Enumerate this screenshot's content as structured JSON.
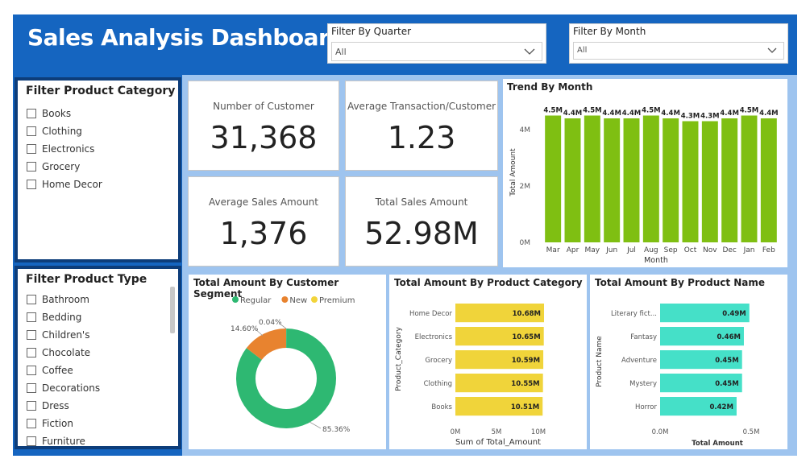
{
  "header": {
    "title": "Sales Analysis Dashboard"
  },
  "filters": {
    "quarter": {
      "label": "Filter By Quarter",
      "value": "All"
    },
    "month": {
      "label": "Filter By Month",
      "value": "All"
    }
  },
  "category_filter": {
    "title": "Filter Product Category",
    "items": [
      "Books",
      "Clothing",
      "Electronics",
      "Grocery",
      "Home Decor"
    ]
  },
  "type_filter": {
    "title": "Filter Product Type",
    "items": [
      "Bathroom",
      "Bedding",
      "Children's",
      "Chocolate",
      "Coffee",
      "Decorations",
      "Dress",
      "Fiction",
      "Furniture"
    ]
  },
  "kpis": {
    "customers": {
      "label": "Number of Customer",
      "value": "31,368"
    },
    "avg_txn": {
      "label": "Average Transaction/Customer",
      "value": "1.23"
    },
    "avg_sales": {
      "label": "Average Sales Amount",
      "value": "1,376"
    },
    "total_sales": {
      "label": "Total Sales Amount",
      "value": "52.98M"
    }
  },
  "colors": {
    "frame": "#1565C0",
    "dark_border": "#0d3d7a",
    "panel_bg": "#9ec4ef",
    "green_bar": "#7FBF12",
    "yellow_bar": "#F0D43A",
    "teal_bar": "#45E0C8",
    "regular": "#2EB872",
    "new": "#E8832F",
    "premium": "#F2D43A"
  },
  "chart_data": [
    {
      "id": "trend",
      "type": "bar",
      "title": "Trend By Month",
      "xlabel": "Month",
      "ylabel": "Total Amount",
      "categories": [
        "Mar",
        "Apr",
        "May",
        "Jun",
        "Jul",
        "Aug",
        "Sep",
        "Oct",
        "Nov",
        "Dec",
        "Jan",
        "Feb"
      ],
      "values": [
        4.5,
        4.4,
        4.5,
        4.4,
        4.4,
        4.5,
        4.4,
        4.3,
        4.3,
        4.4,
        4.5,
        4.4
      ],
      "labels": [
        "4.5M",
        "4.4M",
        "4.5M",
        "4.4M",
        "4.4M",
        "4.5M",
        "4.4M",
        "4.3M",
        "4.3M",
        "4.4M",
        "4.5M",
        "4.4M"
      ],
      "yticks": [
        "0M",
        "2M",
        "4M"
      ],
      "ylim": [
        0,
        5
      ]
    },
    {
      "id": "segment",
      "type": "pie",
      "title": "Total Amount By Customer Segment",
      "categories": [
        "Regular",
        "New",
        "Premium"
      ],
      "values": [
        85.36,
        14.6,
        0.04
      ],
      "labels": [
        "85.36%",
        "14.60%",
        "0.04%"
      ],
      "legend": "top"
    },
    {
      "id": "category",
      "type": "bar",
      "orientation": "horizontal",
      "title": "Total Amount By Product Category",
      "xlabel": "Sum of Total_Amount",
      "ylabel": "Product_Category",
      "categories": [
        "Home Decor",
        "Electronics",
        "Grocery",
        "Clothing",
        "Books"
      ],
      "values": [
        10.68,
        10.65,
        10.59,
        10.55,
        10.51
      ],
      "labels": [
        "10.68M",
        "10.65M",
        "10.59M",
        "10.55M",
        "10.51M"
      ],
      "xticks": [
        "0M",
        "5M",
        "10M"
      ],
      "xlim": [
        0,
        10
      ]
    },
    {
      "id": "product",
      "type": "bar",
      "orientation": "horizontal",
      "title": "Total Amount By Product Name",
      "xlabel": "Total Amount",
      "ylabel": "Product Name",
      "categories": [
        "Literary fict...",
        "Fantasy",
        "Adventure",
        "Mystery",
        "Horror"
      ],
      "values": [
        0.49,
        0.46,
        0.45,
        0.45,
        0.42
      ],
      "labels": [
        "0.49M",
        "0.46M",
        "0.45M",
        "0.45M",
        "0.42M"
      ],
      "xticks": [
        "0.0M",
        "0.5M"
      ],
      "xlim": [
        0,
        0.5
      ]
    }
  ]
}
